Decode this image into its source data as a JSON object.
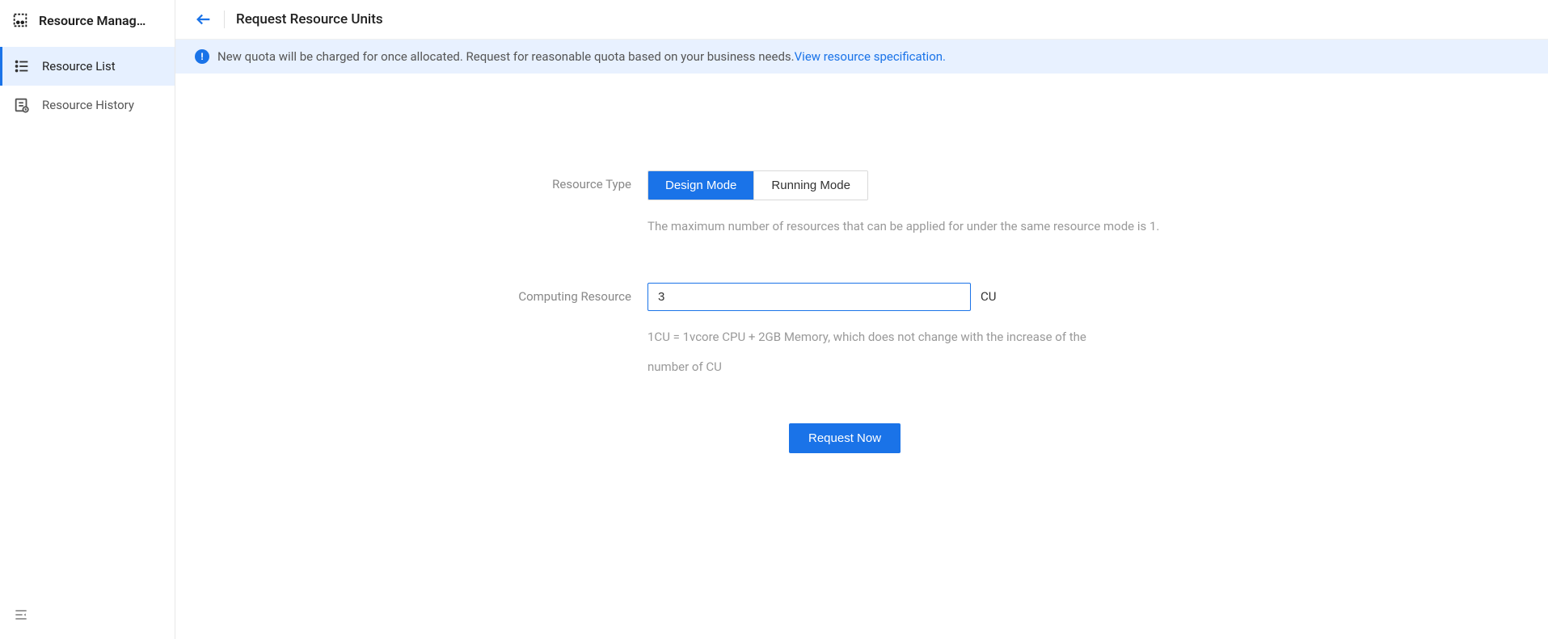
{
  "sidebar": {
    "title": "Resource Manag…",
    "items": [
      {
        "label": "Resource List",
        "active": true
      },
      {
        "label": "Resource History",
        "active": false
      }
    ]
  },
  "header": {
    "title": "Request Resource Units"
  },
  "alert": {
    "text": "New quota will be charged for once allocated. Request for reasonable quota based on your business needs.",
    "link_text": "View resource specification."
  },
  "form": {
    "resource_type": {
      "label": "Resource Type",
      "options": {
        "design": "Design Mode",
        "running": "Running Mode"
      },
      "help": "The maximum number of resources that can be applied for under the same resource mode is 1."
    },
    "computing_resource": {
      "label": "Computing Resource",
      "value": "3",
      "suffix": "CU",
      "help": "1CU = 1vcore CPU + 2GB Memory, which does not change with the increase of the number of CU"
    },
    "submit_label": "Request Now"
  }
}
